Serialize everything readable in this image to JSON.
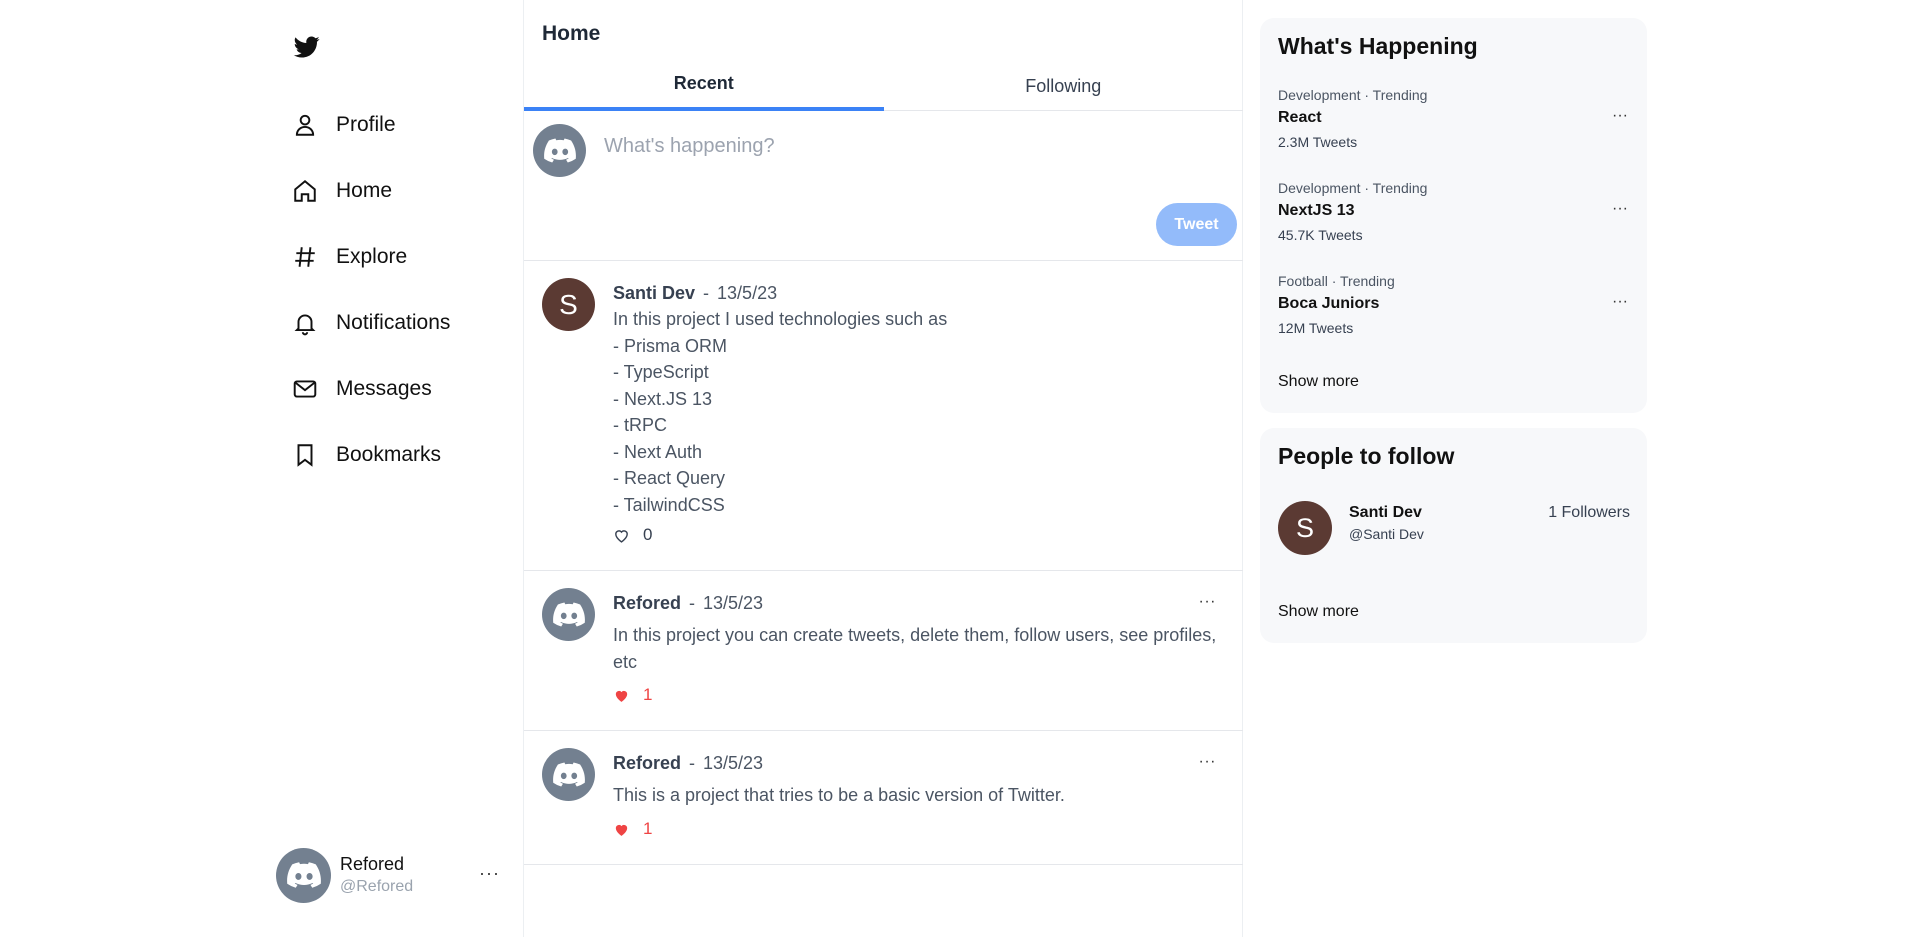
{
  "sidebar": {
    "logo_icon": "twitter-bird-icon",
    "items": [
      {
        "label": "Profile",
        "icon": "user-icon"
      },
      {
        "label": "Home",
        "icon": "home-icon"
      },
      {
        "label": "Explore",
        "icon": "hashtag-icon"
      },
      {
        "label": "Notifications",
        "icon": "bell-icon"
      },
      {
        "label": "Messages",
        "icon": "envelope-icon"
      },
      {
        "label": "Bookmarks",
        "icon": "bookmark-icon"
      }
    ],
    "current_user": {
      "name": "Refored",
      "handle": "@Refored",
      "avatar_icon": "discord-icon"
    }
  },
  "main": {
    "title": "Home",
    "tabs": [
      {
        "label": "Recent",
        "active": true
      },
      {
        "label": "Following",
        "active": false
      }
    ],
    "composer": {
      "placeholder": "What's happening?",
      "button_label": "Tweet",
      "avatar_icon": "discord-icon"
    },
    "posts": [
      {
        "author": "Santi Dev",
        "separator": "-",
        "date": "13/5/23",
        "avatar_letter": "S",
        "lines": [
          "In this project I used technologies such as",
          "- Prisma ORM",
          "- TypeScript",
          "- Next.JS 13",
          "- tRPC",
          "- Next Auth",
          "- React Query",
          "- TailwindCSS"
        ],
        "likes": "0",
        "liked": false
      },
      {
        "author": "Refored",
        "separator": "-",
        "date": "13/5/23",
        "avatar_icon": "discord-icon",
        "text": "In this project you can create tweets, delete them, follow users, see profiles, etc",
        "likes": "1",
        "liked": true,
        "menu": "···"
      },
      {
        "author": "Refored",
        "separator": "-",
        "date": "13/5/23",
        "avatar_icon": "discord-icon",
        "text": "This is a project that tries to be a basic version of Twitter.",
        "likes": "1",
        "liked": true,
        "menu": "···"
      }
    ]
  },
  "right": {
    "trends_title": "What's Happening",
    "trends": [
      {
        "category": "Development · Trending",
        "name": "React",
        "count": "2.3M Tweets"
      },
      {
        "category": "Development · Trending",
        "name": "NextJS 13",
        "count": "45.7K Tweets"
      },
      {
        "category": "Football · Trending",
        "name": "Boca Juniors",
        "count": "12M Tweets"
      }
    ],
    "trends_more": "Show more",
    "follow_title": "People to follow",
    "follow": [
      {
        "name": "Santi Dev",
        "handle": "@Santi Dev",
        "followers": "1 Followers",
        "avatar_letter": "S"
      }
    ],
    "follow_more": "Show more",
    "menu": "···"
  },
  "colors": {
    "accent": "#3b82f6",
    "tweet_button": "#93bbfa",
    "like_red": "#ef4444",
    "avatar_brown": "#5b3a33",
    "avatar_gray": "#738090"
  }
}
